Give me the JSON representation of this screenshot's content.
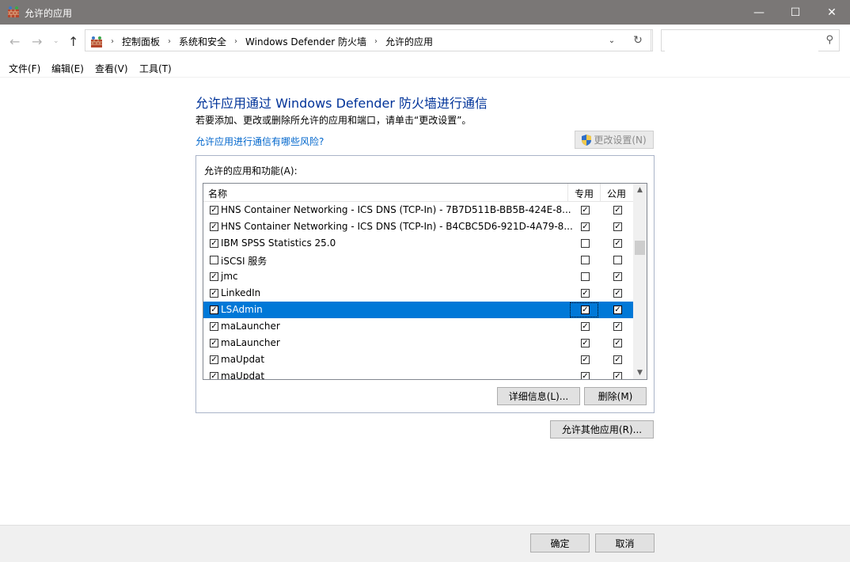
{
  "window": {
    "title": "允许的应用",
    "minimize": "—",
    "maximize": "☐",
    "close": "✕"
  },
  "address": {
    "crumbs": [
      "控制面板",
      "系统和安全",
      "Windows Defender 防火墙",
      "允许的应用"
    ],
    "search_placeholder": ""
  },
  "menu": [
    "文件(F)",
    "编辑(E)",
    "查看(V)",
    "工具(T)"
  ],
  "main": {
    "heading": "允许应用通过 Windows Defender 防火墙进行通信",
    "subtext": "若要添加、更改或删除所允许的应用和端口，请单击“更改设置”。",
    "risk_link": "允许应用进行通信有哪些风险?",
    "change_settings": "更改设置(N)",
    "group_label": "允许的应用和功能(A):",
    "columns": {
      "name": "名称",
      "private": "专用",
      "public": "公用"
    },
    "rows": [
      {
        "name": "HNS Container Networking - ICS DNS (TCP-In) - 7B7D511B-BB5B-424E-8...",
        "enabled": true,
        "private": true,
        "public": true
      },
      {
        "name": "HNS Container Networking - ICS DNS (TCP-In) - B4CBC5D6-921D-4A79-8...",
        "enabled": true,
        "private": true,
        "public": true
      },
      {
        "name": "IBM SPSS Statistics 25.0",
        "enabled": true,
        "private": false,
        "public": true
      },
      {
        "name": "iSCSI 服务",
        "enabled": false,
        "private": false,
        "public": false
      },
      {
        "name": "jmc",
        "enabled": true,
        "private": false,
        "public": true
      },
      {
        "name": "LinkedIn",
        "enabled": true,
        "private": true,
        "public": true
      },
      {
        "name": "LSAdmin",
        "enabled": true,
        "private": true,
        "public": true,
        "selected": true
      },
      {
        "name": "maLauncher",
        "enabled": true,
        "private": true,
        "public": true
      },
      {
        "name": "maLauncher",
        "enabled": true,
        "private": true,
        "public": true
      },
      {
        "name": "maUpdat",
        "enabled": true,
        "private": true,
        "public": true
      },
      {
        "name": "maUpdat",
        "enabled": true,
        "private": true,
        "public": true
      }
    ],
    "details_button": "详细信息(L)...",
    "delete_button": "删除(M)",
    "allow_other_button": "允许其他应用(R)..."
  },
  "footer": {
    "ok": "确定",
    "cancel": "取消"
  },
  "colors": {
    "titlebar": "#7a7776",
    "selection": "#0078d7",
    "heading": "#003399",
    "link": "#0066cc"
  }
}
